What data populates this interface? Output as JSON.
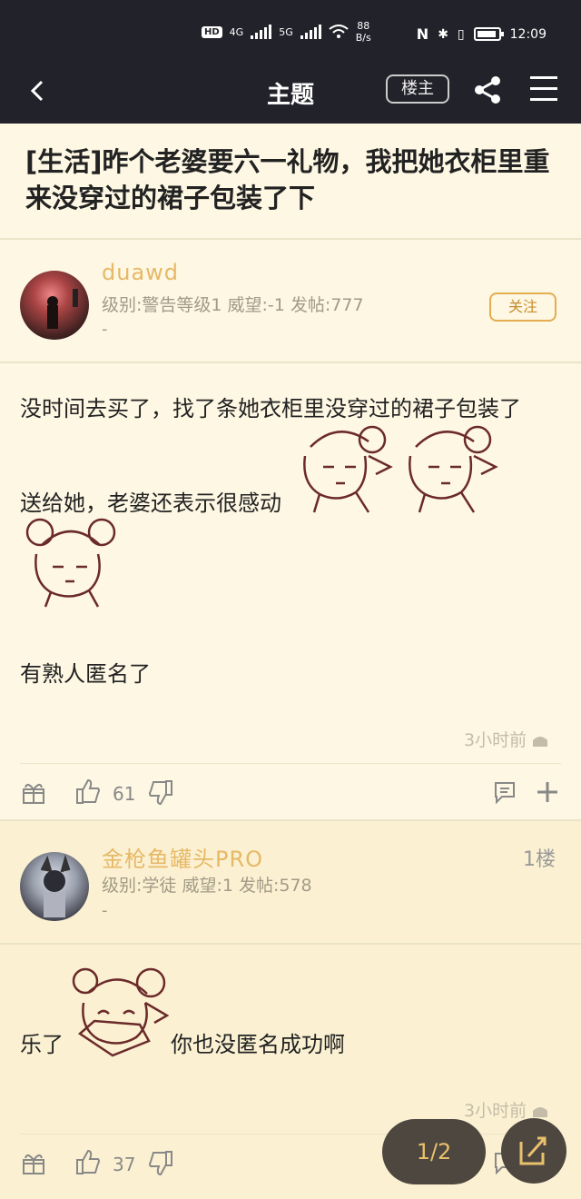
{
  "status": {
    "network_label": "HD",
    "net1": "4G",
    "net2": "5G",
    "speed_value": "88",
    "speed_unit": "B/s",
    "time": "12:09"
  },
  "nav": {
    "back_label": "<",
    "title": "主题",
    "op_button": "楼主"
  },
  "thread": {
    "title": "[生活]昨个老婆要六一礼物，我把她衣柜里重来没穿过的裙子包装了下"
  },
  "posts": [
    {
      "author": "duawd",
      "meta": "级别:警告等级1 威望:-1 发帖:777",
      "dash": "-",
      "follow_label": "关注",
      "lines": [
        "没时间去买了，找了条她衣柜里没穿过的裙子包装了",
        "送给她，老婆还表示很感动",
        "有熟人匿名了"
      ],
      "time": "3小时前",
      "likes": "61"
    },
    {
      "author": "金枪鱼罐头PRO",
      "floor": "1楼",
      "meta": "级别:学徒 威望:1 发帖:578",
      "dash": "-",
      "lines": [
        "乐了",
        "你也没匿名成功啊"
      ],
      "time": "3小时前",
      "likes": "37"
    }
  ],
  "pager": {
    "label": "1/2"
  },
  "colors": {
    "bar": "#22222a",
    "bg": "#fdf7e3",
    "accent": "#e7b866"
  }
}
